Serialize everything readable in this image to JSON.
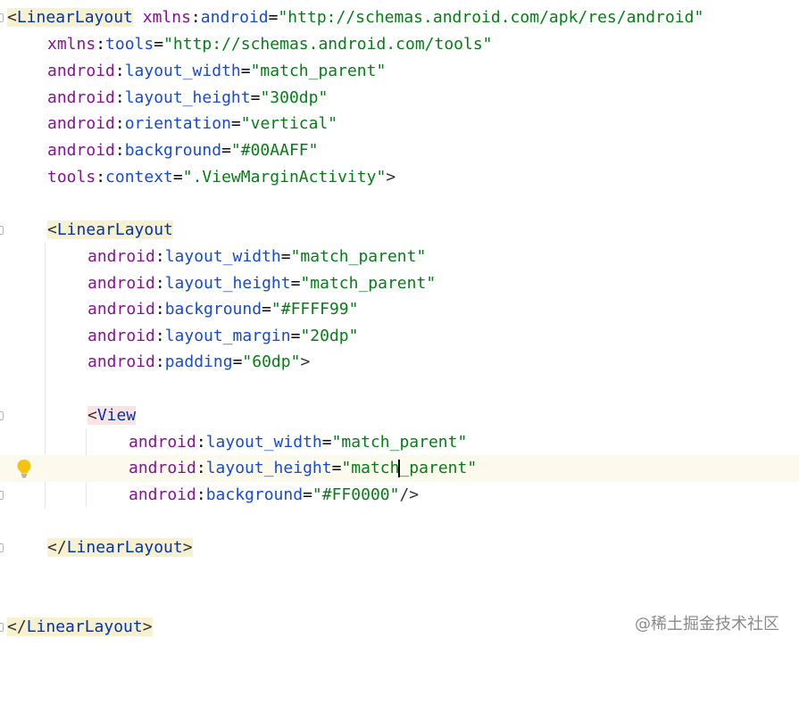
{
  "editor": {
    "language": "xml",
    "colors": {
      "background": "#ffffff",
      "tag": "#0033b3",
      "namespace": "#871094",
      "attribute": "#174ad4",
      "value": "#067d17",
      "current_line": "#fcfaed"
    },
    "lines": {
      "l1": {
        "open": "<",
        "tag": "LinearLayout",
        "attrs": [
          {
            "ns": "xmlns",
            "name": "android",
            "value": "\"http://schemas.android.com/apk/res/android\""
          }
        ]
      },
      "l2": {
        "ns": "xmlns",
        "name": "tools",
        "value": "\"http://schemas.android.com/tools\""
      },
      "l3": {
        "ns": "android",
        "name": "layout_width",
        "value": "\"match_parent\""
      },
      "l4": {
        "ns": "android",
        "name": "layout_height",
        "value": "\"300dp\""
      },
      "l5": {
        "ns": "android",
        "name": "orientation",
        "value": "\"vertical\""
      },
      "l6": {
        "ns": "android",
        "name": "background",
        "value": "\"#00AAFF\""
      },
      "l7": {
        "ns": "tools",
        "name": "context",
        "value": "\".ViewMarginActivity\"",
        "close": ">"
      },
      "l9": {
        "open": "<",
        "tag": "LinearLayout"
      },
      "l10": {
        "ns": "android",
        "name": "layout_width",
        "value": "\"match_parent\""
      },
      "l11": {
        "ns": "android",
        "name": "layout_height",
        "value": "\"match_parent\""
      },
      "l12": {
        "ns": "android",
        "name": "background",
        "value": "\"#FFFF99\""
      },
      "l13": {
        "ns": "android",
        "name": "layout_margin",
        "value": "\"20dp\""
      },
      "l14": {
        "ns": "android",
        "name": "padding",
        "value": "\"60dp\"",
        "close": ">"
      },
      "l16": {
        "open": "<",
        "tag": "View"
      },
      "l17": {
        "ns": "android",
        "name": "layout_width",
        "value": "\"match_parent\""
      },
      "l18": {
        "ns": "android",
        "name": "layout_height",
        "value_before_caret": "\"match",
        "value_after_caret": "_parent\""
      },
      "l19": {
        "ns": "android",
        "name": "background",
        "value": "\"#FF0000\"",
        "close": "/>"
      },
      "l21": {
        "open": "</",
        "tag": "LinearLayout",
        "close": ">"
      },
      "l24": {
        "open": "</",
        "tag": "LinearLayout",
        "close": ">"
      }
    },
    "punct": {
      "colon": ":",
      "equals": "=",
      "space": " "
    },
    "gutter_icon": "lightbulb-icon",
    "fold_icon": "fold-marker-icon"
  },
  "watermark": {
    "text": "@稀土掘金技术社区"
  }
}
